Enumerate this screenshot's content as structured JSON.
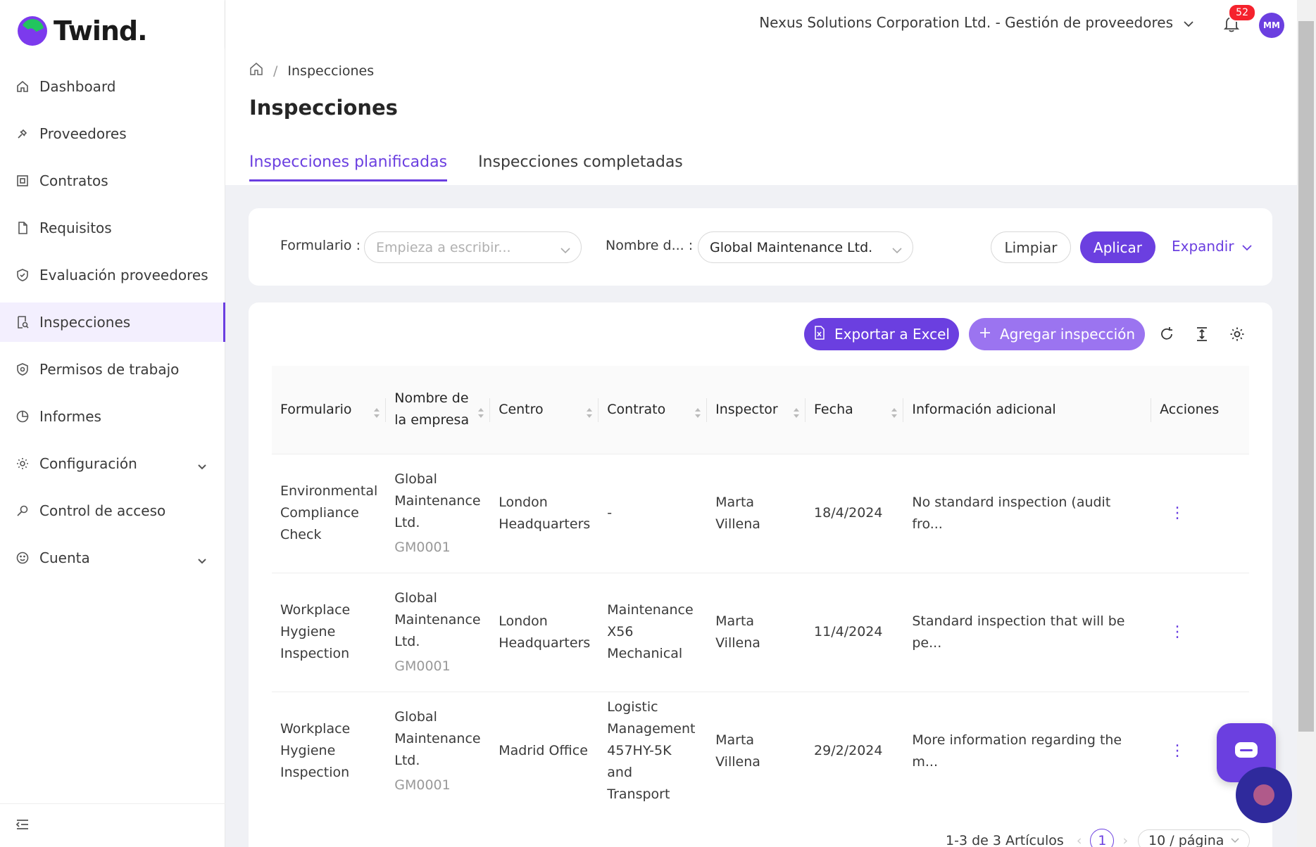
{
  "app": {
    "logo_text": "Twind."
  },
  "sidebar": {
    "items": [
      {
        "label": "Dashboard",
        "icon": "home-icon"
      },
      {
        "label": "Proveedores",
        "icon": "supplier-icon"
      },
      {
        "label": "Contratos",
        "icon": "contract-icon"
      },
      {
        "label": "Requisitos",
        "icon": "document-icon"
      },
      {
        "label": "Evaluación proveedores",
        "icon": "shield-check-icon"
      },
      {
        "label": "Inspecciones",
        "icon": "inspection-icon",
        "active": true
      },
      {
        "label": "Permisos de trabajo",
        "icon": "shield-icon"
      },
      {
        "label": "Informes",
        "icon": "pie-chart-icon"
      },
      {
        "label": "Configuración",
        "icon": "gear-icon",
        "expandable": true
      },
      {
        "label": "Control de acceso",
        "icon": "key-icon"
      },
      {
        "label": "Cuenta",
        "icon": "smile-icon",
        "expandable": true
      }
    ]
  },
  "header": {
    "org": "Nexus Solutions Corporation Ltd. - Gestión de proveedores",
    "notifications": "52",
    "avatar": "MM"
  },
  "breadcrumb": {
    "current": "Inspecciones"
  },
  "page": {
    "title": "Inspecciones"
  },
  "tabs": [
    {
      "label": "Inspecciones planificadas",
      "active": true
    },
    {
      "label": "Inspecciones completadas"
    }
  ],
  "filters": {
    "formulario_label": "Formulario",
    "formulario_placeholder": "Empieza a escribir...",
    "nombre_label": "Nombre d...",
    "nombre_value": "Global Maintenance Ltd.",
    "clear": "Limpiar",
    "apply": "Aplicar",
    "expand": "Expandir"
  },
  "toolbar": {
    "export": "Exportar a Excel",
    "add": "Agregar inspección"
  },
  "table": {
    "headers": [
      "Formulario",
      "Nombre de la empresa",
      "Centro",
      "Contrato",
      "Inspector",
      "Fecha",
      "Información adicional",
      "Acciones"
    ],
    "rows": [
      {
        "formulario": "Environmental Compliance Check",
        "empresa": "Global Maintenance Ltd.",
        "codigo": "GM0001",
        "centro": "London Headquarters",
        "contrato": "-",
        "inspector": "Marta Villena",
        "fecha": "18/4/2024",
        "info": "No standard inspection (audit fro..."
      },
      {
        "formulario": "Workplace Hygiene Inspection",
        "empresa": "Global Maintenance Ltd.",
        "codigo": "GM0001",
        "centro": "London Headquarters",
        "contrato": "Maintenance X56 Mechanical",
        "inspector": "Marta Villena",
        "fecha": "11/4/2024",
        "info": "Standard inspection that will be pe..."
      },
      {
        "formulario": "Workplace Hygiene Inspection",
        "empresa": "Global Maintenance Ltd.",
        "codigo": "GM0001",
        "centro": "Madrid Office",
        "contrato": "Logistic Management 457HY-5K and Transport",
        "inspector": "Marta Villena",
        "fecha": "29/2/2024",
        "info": "More information regarding the m..."
      }
    ]
  },
  "pagination": {
    "summary": "1-3 de 3 Artículos",
    "current": "1",
    "page_size": "10 / página"
  },
  "colors": {
    "accent": "#6b3fe0",
    "accent_light": "#9b74f0",
    "badge": "#f5222d"
  }
}
